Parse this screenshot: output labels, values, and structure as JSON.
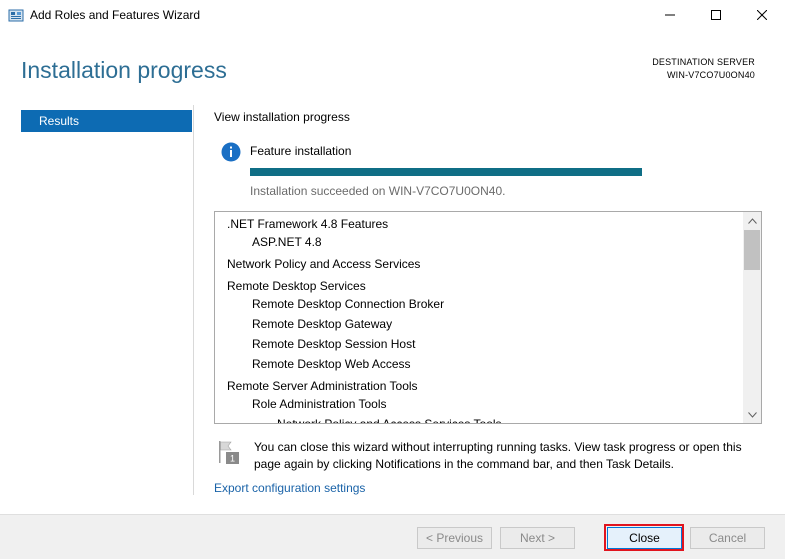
{
  "window": {
    "title": "Add Roles and Features Wizard"
  },
  "header": {
    "title": "Installation progress",
    "destination_label": "DESTINATION SERVER",
    "destination_name": "WIN-V7CO7U0ON40"
  },
  "nav": {
    "items": [
      {
        "label": "Results",
        "active": true
      }
    ]
  },
  "content": {
    "view_label": "View installation progress",
    "feature_label": "Feature installation",
    "progress": 1.0,
    "success_text": "Installation succeeded on WIN-V7CO7U0ON40."
  },
  "features": [
    {
      "label": ".NET Framework 4.8 Features",
      "level": 0
    },
    {
      "label": "ASP.NET 4.8",
      "level": 1
    },
    {
      "label": "Network Policy and Access Services",
      "level": 0
    },
    {
      "label": "Remote Desktop Services",
      "level": 0
    },
    {
      "label": "Remote Desktop Connection Broker",
      "level": 1
    },
    {
      "label": "Remote Desktop Gateway",
      "level": 1
    },
    {
      "label": "Remote Desktop Session Host",
      "level": 1
    },
    {
      "label": "Remote Desktop Web Access",
      "level": 1
    },
    {
      "label": "Remote Server Administration Tools",
      "level": 0
    },
    {
      "label": "Role Administration Tools",
      "level": 1
    },
    {
      "label": "Network Policy and Access Services Tools",
      "level": 2
    }
  ],
  "note": {
    "text": "You can close this wizard without interrupting running tasks. View task progress or open this page again by clicking Notifications in the command bar, and then Task Details.",
    "badge": "1"
  },
  "export_link": "Export configuration settings",
  "footer": {
    "previous": "< Previous",
    "next": "Next >",
    "close": "Close",
    "cancel": "Cancel"
  },
  "colors": {
    "accent": "#0d6bb3",
    "title": "#2d6e94",
    "progress": "#0f6e86",
    "highlight": "#e0141e"
  }
}
